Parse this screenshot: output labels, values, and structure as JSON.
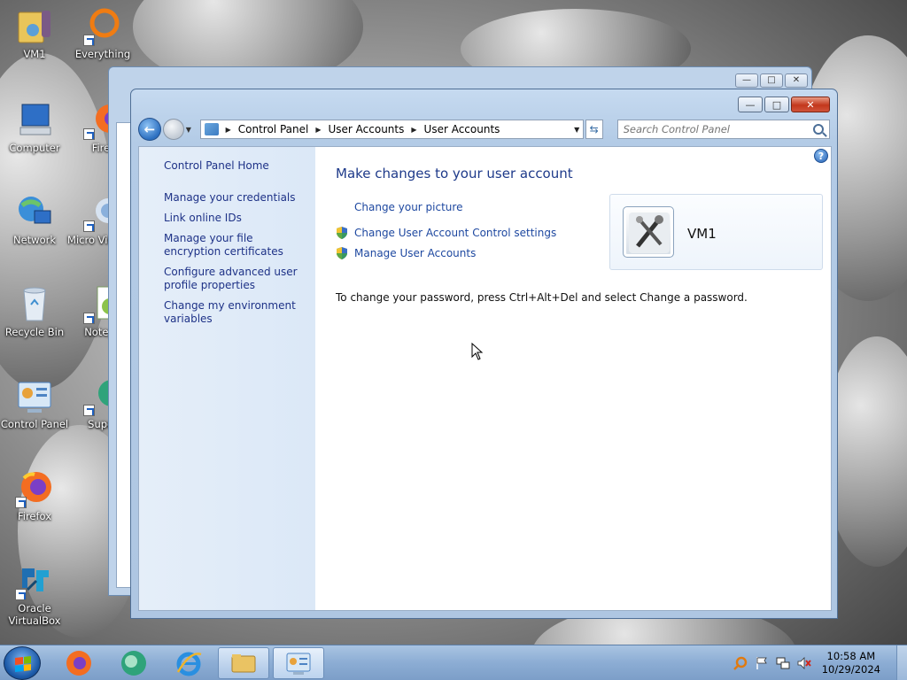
{
  "desktop": {
    "icons": [
      {
        "label": "VM1"
      },
      {
        "label": "Everything"
      },
      {
        "label": "Computer"
      },
      {
        "label": "Firef"
      },
      {
        "label": "Network"
      },
      {
        "label": "Micro Visual S"
      },
      {
        "label": "Recycle Bin"
      },
      {
        "label": "Notepa"
      },
      {
        "label": "Control Panel"
      },
      {
        "label": "Super"
      },
      {
        "label": "Firefox"
      },
      {
        "label": "Oracle VirtualBox"
      }
    ]
  },
  "window": {
    "controls": {
      "minimize": "—",
      "maximize": "□",
      "close": "✕"
    },
    "breadcrumb": [
      "Control Panel",
      "User Accounts",
      "User Accounts"
    ],
    "search_placeholder": "Search Control Panel",
    "sidebar": {
      "home": "Control Panel Home",
      "links": [
        "Manage your credentials",
        "Link online IDs",
        "Manage your file encryption certificates",
        "Configure advanced user profile properties",
        "Change my environment variables"
      ]
    },
    "main": {
      "heading": "Make changes to your user account",
      "tasks": [
        {
          "label": "Change your picture",
          "shield": false
        },
        {
          "label": "Change User Account Control settings",
          "shield": true
        },
        {
          "label": "Manage User Accounts",
          "shield": true
        }
      ],
      "user_name": "VM1",
      "password_note": "To change your password, press Ctrl+Alt+Del and select Change a password.",
      "help_glyph": "?"
    }
  },
  "taskbar": {
    "clock_time": "10:58 AM",
    "clock_date": "10/29/2024"
  },
  "colors": {
    "link": "#1e3287",
    "heading": "#1e3a8a",
    "sidebar_bg": "#dbe8f7",
    "titlebar": "#b3cbe6"
  }
}
